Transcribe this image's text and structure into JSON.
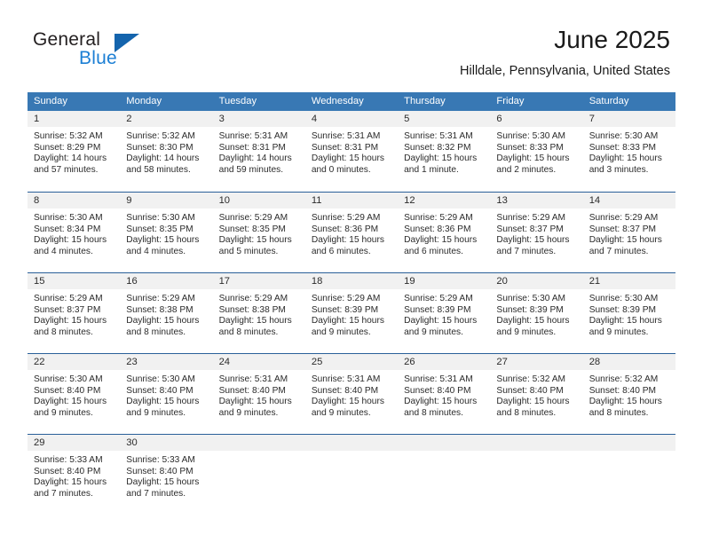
{
  "brand": {
    "name_part1": "General",
    "name_part2": "Blue",
    "logo_icon": "triangle-logo-icon"
  },
  "header": {
    "title": "June 2025",
    "location": "Hilldale, Pennsylvania, United States"
  },
  "calendar": {
    "weekday_headers": [
      "Sunday",
      "Monday",
      "Tuesday",
      "Wednesday",
      "Thursday",
      "Friday",
      "Saturday"
    ],
    "accent_color": "#3878b4",
    "row_rule_color": "#2a6099",
    "daynum_band_color": "#f1f1f1",
    "weeks": [
      [
        {
          "day": "1",
          "sunrise": "Sunrise: 5:32 AM",
          "sunset": "Sunset: 8:29 PM",
          "daylight_line1": "Daylight: 14 hours",
          "daylight_line2": "and 57 minutes."
        },
        {
          "day": "2",
          "sunrise": "Sunrise: 5:32 AM",
          "sunset": "Sunset: 8:30 PM",
          "daylight_line1": "Daylight: 14 hours",
          "daylight_line2": "and 58 minutes."
        },
        {
          "day": "3",
          "sunrise": "Sunrise: 5:31 AM",
          "sunset": "Sunset: 8:31 PM",
          "daylight_line1": "Daylight: 14 hours",
          "daylight_line2": "and 59 minutes."
        },
        {
          "day": "4",
          "sunrise": "Sunrise: 5:31 AM",
          "sunset": "Sunset: 8:31 PM",
          "daylight_line1": "Daylight: 15 hours",
          "daylight_line2": "and 0 minutes."
        },
        {
          "day": "5",
          "sunrise": "Sunrise: 5:31 AM",
          "sunset": "Sunset: 8:32 PM",
          "daylight_line1": "Daylight: 15 hours",
          "daylight_line2": "and 1 minute."
        },
        {
          "day": "6",
          "sunrise": "Sunrise: 5:30 AM",
          "sunset": "Sunset: 8:33 PM",
          "daylight_line1": "Daylight: 15 hours",
          "daylight_line2": "and 2 minutes."
        },
        {
          "day": "7",
          "sunrise": "Sunrise: 5:30 AM",
          "sunset": "Sunset: 8:33 PM",
          "daylight_line1": "Daylight: 15 hours",
          "daylight_line2": "and 3 minutes."
        }
      ],
      [
        {
          "day": "8",
          "sunrise": "Sunrise: 5:30 AM",
          "sunset": "Sunset: 8:34 PM",
          "daylight_line1": "Daylight: 15 hours",
          "daylight_line2": "and 4 minutes."
        },
        {
          "day": "9",
          "sunrise": "Sunrise: 5:30 AM",
          "sunset": "Sunset: 8:35 PM",
          "daylight_line1": "Daylight: 15 hours",
          "daylight_line2": "and 4 minutes."
        },
        {
          "day": "10",
          "sunrise": "Sunrise: 5:29 AM",
          "sunset": "Sunset: 8:35 PM",
          "daylight_line1": "Daylight: 15 hours",
          "daylight_line2": "and 5 minutes."
        },
        {
          "day": "11",
          "sunrise": "Sunrise: 5:29 AM",
          "sunset": "Sunset: 8:36 PM",
          "daylight_line1": "Daylight: 15 hours",
          "daylight_line2": "and 6 minutes."
        },
        {
          "day": "12",
          "sunrise": "Sunrise: 5:29 AM",
          "sunset": "Sunset: 8:36 PM",
          "daylight_line1": "Daylight: 15 hours",
          "daylight_line2": "and 6 minutes."
        },
        {
          "day": "13",
          "sunrise": "Sunrise: 5:29 AM",
          "sunset": "Sunset: 8:37 PM",
          "daylight_line1": "Daylight: 15 hours",
          "daylight_line2": "and 7 minutes."
        },
        {
          "day": "14",
          "sunrise": "Sunrise: 5:29 AM",
          "sunset": "Sunset: 8:37 PM",
          "daylight_line1": "Daylight: 15 hours",
          "daylight_line2": "and 7 minutes."
        }
      ],
      [
        {
          "day": "15",
          "sunrise": "Sunrise: 5:29 AM",
          "sunset": "Sunset: 8:37 PM",
          "daylight_line1": "Daylight: 15 hours",
          "daylight_line2": "and 8 minutes."
        },
        {
          "day": "16",
          "sunrise": "Sunrise: 5:29 AM",
          "sunset": "Sunset: 8:38 PM",
          "daylight_line1": "Daylight: 15 hours",
          "daylight_line2": "and 8 minutes."
        },
        {
          "day": "17",
          "sunrise": "Sunrise: 5:29 AM",
          "sunset": "Sunset: 8:38 PM",
          "daylight_line1": "Daylight: 15 hours",
          "daylight_line2": "and 8 minutes."
        },
        {
          "day": "18",
          "sunrise": "Sunrise: 5:29 AM",
          "sunset": "Sunset: 8:39 PM",
          "daylight_line1": "Daylight: 15 hours",
          "daylight_line2": "and 9 minutes."
        },
        {
          "day": "19",
          "sunrise": "Sunrise: 5:29 AM",
          "sunset": "Sunset: 8:39 PM",
          "daylight_line1": "Daylight: 15 hours",
          "daylight_line2": "and 9 minutes."
        },
        {
          "day": "20",
          "sunrise": "Sunrise: 5:30 AM",
          "sunset": "Sunset: 8:39 PM",
          "daylight_line1": "Daylight: 15 hours",
          "daylight_line2": "and 9 minutes."
        },
        {
          "day": "21",
          "sunrise": "Sunrise: 5:30 AM",
          "sunset": "Sunset: 8:39 PM",
          "daylight_line1": "Daylight: 15 hours",
          "daylight_line2": "and 9 minutes."
        }
      ],
      [
        {
          "day": "22",
          "sunrise": "Sunrise: 5:30 AM",
          "sunset": "Sunset: 8:40 PM",
          "daylight_line1": "Daylight: 15 hours",
          "daylight_line2": "and 9 minutes."
        },
        {
          "day": "23",
          "sunrise": "Sunrise: 5:30 AM",
          "sunset": "Sunset: 8:40 PM",
          "daylight_line1": "Daylight: 15 hours",
          "daylight_line2": "and 9 minutes."
        },
        {
          "day": "24",
          "sunrise": "Sunrise: 5:31 AM",
          "sunset": "Sunset: 8:40 PM",
          "daylight_line1": "Daylight: 15 hours",
          "daylight_line2": "and 9 minutes."
        },
        {
          "day": "25",
          "sunrise": "Sunrise: 5:31 AM",
          "sunset": "Sunset: 8:40 PM",
          "daylight_line1": "Daylight: 15 hours",
          "daylight_line2": "and 9 minutes."
        },
        {
          "day": "26",
          "sunrise": "Sunrise: 5:31 AM",
          "sunset": "Sunset: 8:40 PM",
          "daylight_line1": "Daylight: 15 hours",
          "daylight_line2": "and 8 minutes."
        },
        {
          "day": "27",
          "sunrise": "Sunrise: 5:32 AM",
          "sunset": "Sunset: 8:40 PM",
          "daylight_line1": "Daylight: 15 hours",
          "daylight_line2": "and 8 minutes."
        },
        {
          "day": "28",
          "sunrise": "Sunrise: 5:32 AM",
          "sunset": "Sunset: 8:40 PM",
          "daylight_line1": "Daylight: 15 hours",
          "daylight_line2": "and 8 minutes."
        }
      ],
      [
        {
          "day": "29",
          "sunrise": "Sunrise: 5:33 AM",
          "sunset": "Sunset: 8:40 PM",
          "daylight_line1": "Daylight: 15 hours",
          "daylight_line2": "and 7 minutes."
        },
        {
          "day": "30",
          "sunrise": "Sunrise: 5:33 AM",
          "sunset": "Sunset: 8:40 PM",
          "daylight_line1": "Daylight: 15 hours",
          "daylight_line2": "and 7 minutes."
        },
        {
          "day": "",
          "sunrise": "",
          "sunset": "",
          "daylight_line1": "",
          "daylight_line2": ""
        },
        {
          "day": "",
          "sunrise": "",
          "sunset": "",
          "daylight_line1": "",
          "daylight_line2": ""
        },
        {
          "day": "",
          "sunrise": "",
          "sunset": "",
          "daylight_line1": "",
          "daylight_line2": ""
        },
        {
          "day": "",
          "sunrise": "",
          "sunset": "",
          "daylight_line1": "",
          "daylight_line2": ""
        },
        {
          "day": "",
          "sunrise": "",
          "sunset": "",
          "daylight_line1": "",
          "daylight_line2": ""
        }
      ]
    ]
  }
}
